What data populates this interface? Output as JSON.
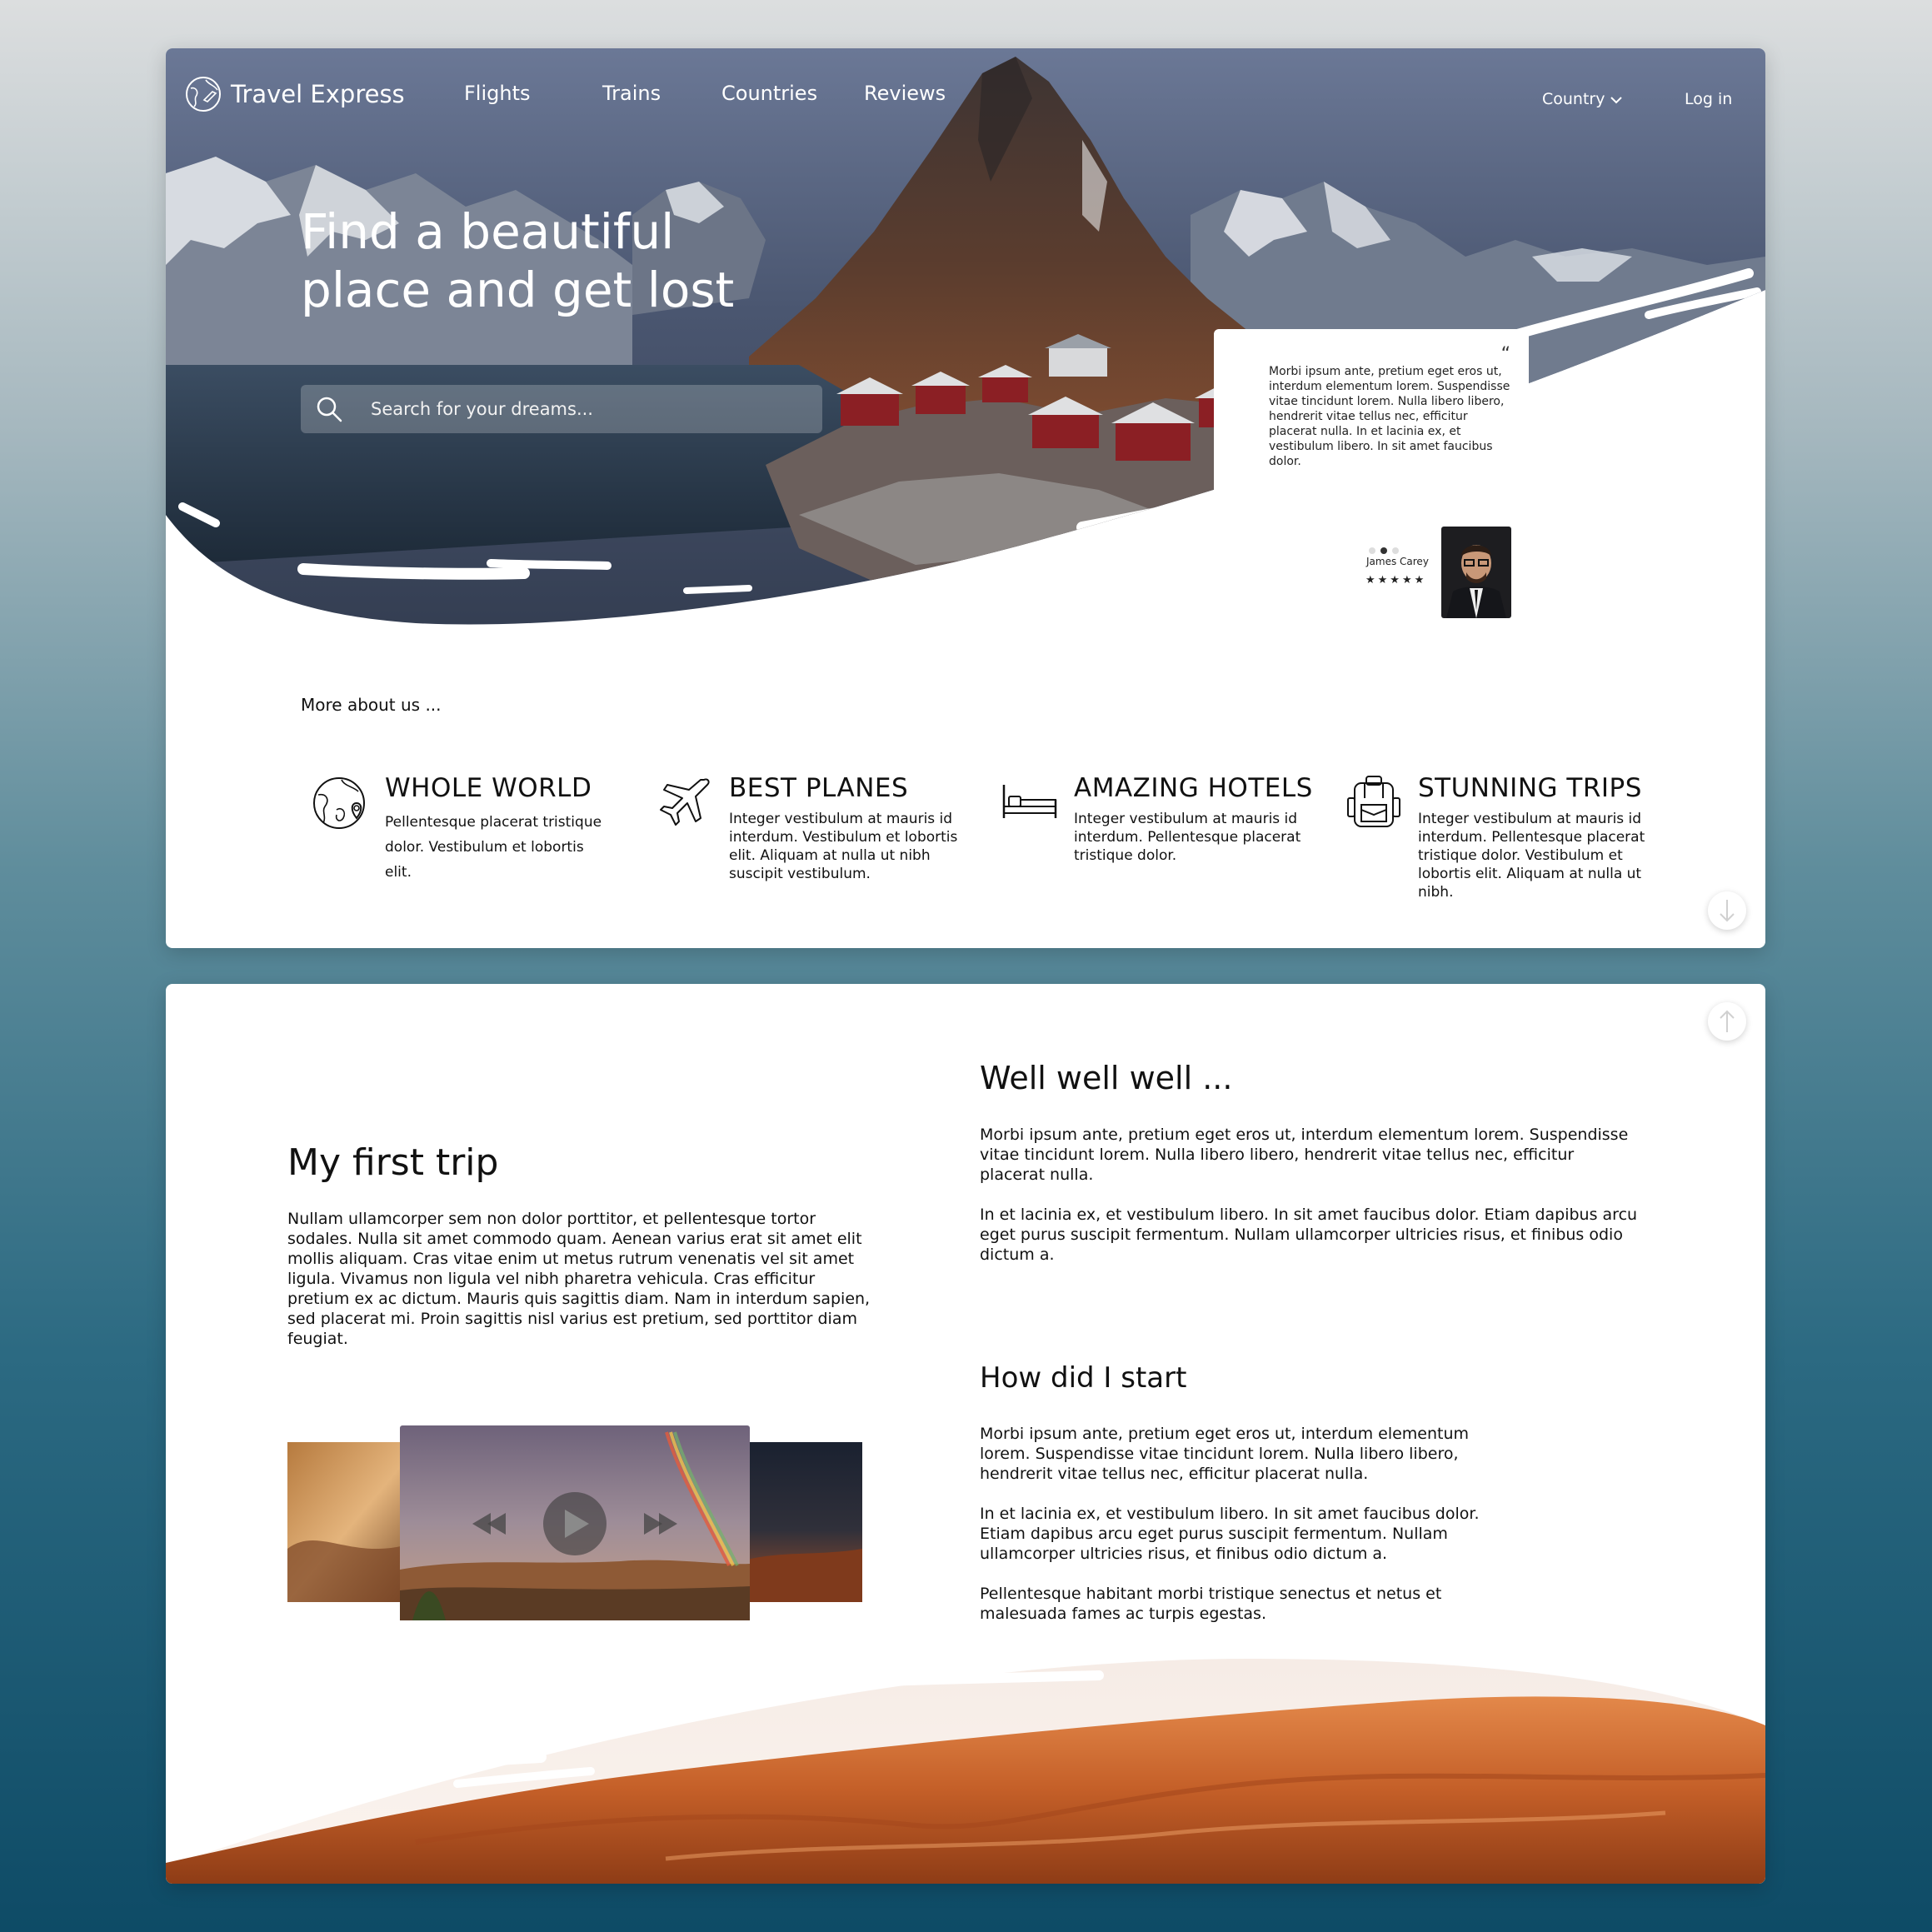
{
  "nav": {
    "brand": "Travel Express",
    "items": [
      "Flights",
      "Trains",
      "Countries",
      "Reviews"
    ],
    "country": "Country",
    "login": "Log in"
  },
  "hero": {
    "headline_line1": "Find a beautiful",
    "headline_line2": "place and get lost",
    "search_placeholder": "Search for your dreams..."
  },
  "review": {
    "quote_mark": "“",
    "text": "Morbi ipsum ante, pretium eget eros ut, interdum elementum lorem. Suspendisse vitae tincidunt lorem. Nulla libero libero, hendrerit vitae tellus nec, efficitur placerat nulla. In et lacinia ex, et vestibulum libero. In sit amet faucibus dolor.",
    "reviewer": "James Carey",
    "stars": "★★★★★",
    "active_slide": 2,
    "slide_count": 3
  },
  "about": {
    "heading": "More about us ...",
    "features": [
      {
        "icon": "globe-pin-icon",
        "title": "WHOLE WORLD",
        "desc": "Pellentesque placerat tristique dolor. Vestibulum et lobortis elit."
      },
      {
        "icon": "plane-icon",
        "title": "BEST PLANES",
        "desc": "Integer vestibulum at mauris id interdum. Vestibulum et lobortis elit. Aliquam at nulla ut nibh suscipit vestibulum."
      },
      {
        "icon": "bed-icon",
        "title": "AMAZING HOTELS",
        "desc": "Integer vestibulum at mauris id interdum. Pellentesque placerat tristique dolor."
      },
      {
        "icon": "backpack-icon",
        "title": "STUNNING TRIPS",
        "desc": "Integer vestibulum at mauris id interdum. Pellentesque placerat tristique dolor. Vestibulum et lobortis elit. Aliquam at nulla ut nibh."
      }
    ]
  },
  "story": {
    "first_title": "My first trip",
    "first_text": "Nullam ullamcorper sem non dolor porttitor, et pellentesque tortor sodales. Nulla sit amet commodo quam. Aenean varius erat sit amet elit mollis aliquam. Cras vitae enim ut metus rutrum venenatis vel sit amet ligula. Vivamus non ligula vel nibh pharetra vehicula. Cras efficitur pretium ex ac dictum. Mauris quis sagittis diam. Nam in interdum sapien, sed placerat mi. Proin sagittis nisl varius est pretium, sed porttitor diam feugiat.",
    "well_title": "Well well well ...",
    "well_p1": "Morbi ipsum ante, pretium eget eros ut, interdum elementum lorem. Suspendisse vitae tincidunt lorem. Nulla libero libero, hendrerit vitae tellus nec, efficitur placerat nulla.",
    "well_p2": "In et lacinia ex, et vestibulum libero. In sit amet faucibus dolor. Etiam dapibus arcu eget purus suscipit fermentum. Nullam ullamcorper ultricies risus, et finibus odio dictum a.",
    "how_title": "How did I start",
    "how_p1": "Morbi ipsum ante, pretium eget eros ut, interdum elementum lorem. Suspendisse vitae tincidunt lorem. Nulla libero libero, hendrerit vitae tellus nec, efficitur placerat nulla.",
    "how_p2": "In et lacinia ex, et vestibulum libero. In sit amet faucibus dolor. Etiam dapibus arcu eget purus suscipit fermentum. Nullam ullamcorper ultricies risus, et finibus odio dictum a.",
    "how_p3": "Pellentesque habitant morbi tristique senectus et netus et malesuada fames ac turpis egestas."
  },
  "colors": {
    "sky": "#5d6a86",
    "water": "#2b3a4c",
    "rock": "#4b3b36",
    "house": "#8b1f24",
    "sand": "#c9642a"
  }
}
